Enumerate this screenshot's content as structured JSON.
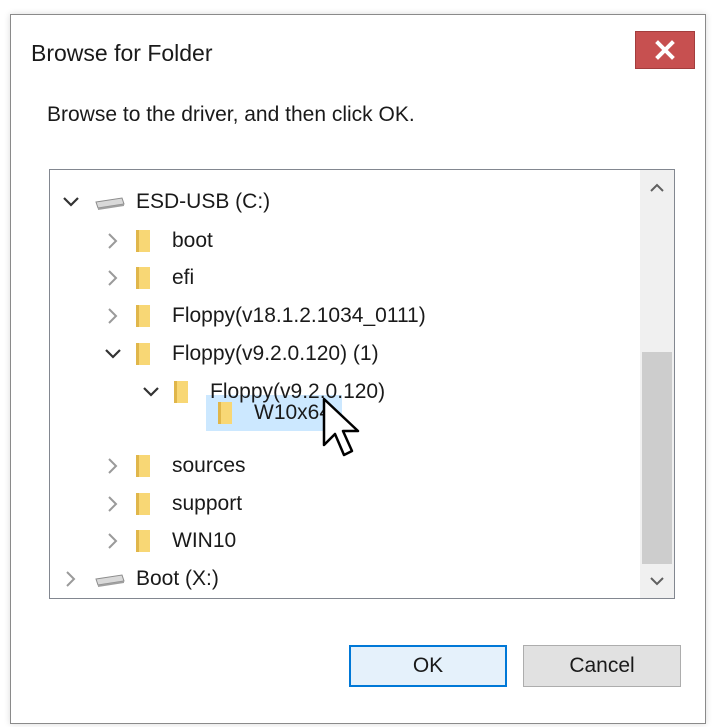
{
  "window": {
    "title": "Browse for Folder",
    "close_label": "close"
  },
  "instruction": "Browse to the driver, and then click OK.",
  "tree": {
    "items": [
      {
        "label": "ESD-USB (C:)",
        "type": "drive",
        "expanded": true,
        "level": 0
      },
      {
        "label": "boot",
        "type": "folder",
        "expanded": false,
        "level": 1
      },
      {
        "label": "efi",
        "type": "folder",
        "expanded": false,
        "level": 1
      },
      {
        "label": "Floppy(v18.1.2.1034_0111)",
        "type": "folder",
        "expanded": false,
        "level": 1
      },
      {
        "label": "Floppy(v9.2.0.120) (1)",
        "type": "folder",
        "expanded": true,
        "level": 1
      },
      {
        "label": "Floppy(v9.2.0.120)",
        "type": "folder",
        "expanded": true,
        "level": 2
      },
      {
        "label": "W10x64",
        "type": "folder",
        "expanded": false,
        "level": 3,
        "selected": true
      },
      {
        "label": "sources",
        "type": "folder",
        "expanded": false,
        "level": 1
      },
      {
        "label": "support",
        "type": "folder",
        "expanded": false,
        "level": 1
      },
      {
        "label": "WIN10",
        "type": "folder",
        "expanded": false,
        "level": 1
      },
      {
        "label": "Boot (X:)",
        "type": "drive",
        "expanded": false,
        "level": 0
      }
    ]
  },
  "buttons": {
    "ok": "OK",
    "cancel": "Cancel"
  },
  "colors": {
    "close_button": "#c75050",
    "selection": "#cce8ff",
    "ok_border": "#0078d7",
    "folder_yellow": "#f8d775"
  }
}
